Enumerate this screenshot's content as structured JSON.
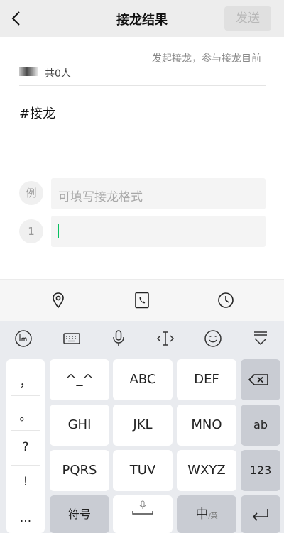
{
  "header": {
    "title": "接龙结果",
    "send_label": "发送"
  },
  "info": {
    "initiator_text": "发起接龙，参与接龙目前",
    "count_text": "共0人"
  },
  "topic": "#接龙",
  "example": {
    "marker": "例",
    "placeholder": "可填写接龙格式"
  },
  "entry": {
    "number": "1",
    "value": ""
  },
  "toolbar": {
    "icons": [
      "location-icon",
      "phone-icon",
      "clock-icon"
    ]
  },
  "keyboard": {
    "tools": [
      "ime-logo-icon",
      "keyboard-icon",
      "microphone-icon",
      "cursor-move-icon",
      "emoji-icon",
      "collapse-keyboard-icon"
    ],
    "punctuation": [
      "，",
      "。",
      "?",
      "!",
      "..."
    ],
    "keys": {
      "k1": "^_^",
      "k2": "ABC",
      "k3": "DEF",
      "k4": "GHI",
      "k5": "JKL",
      "k6": "MNO",
      "k7": "PQRS",
      "k8": "TUV",
      "k9": "WXYZ",
      "symbols": "符号",
      "ab": "ab",
      "num": "123",
      "lang_main": "中",
      "lang_sub": "/英"
    }
  }
}
